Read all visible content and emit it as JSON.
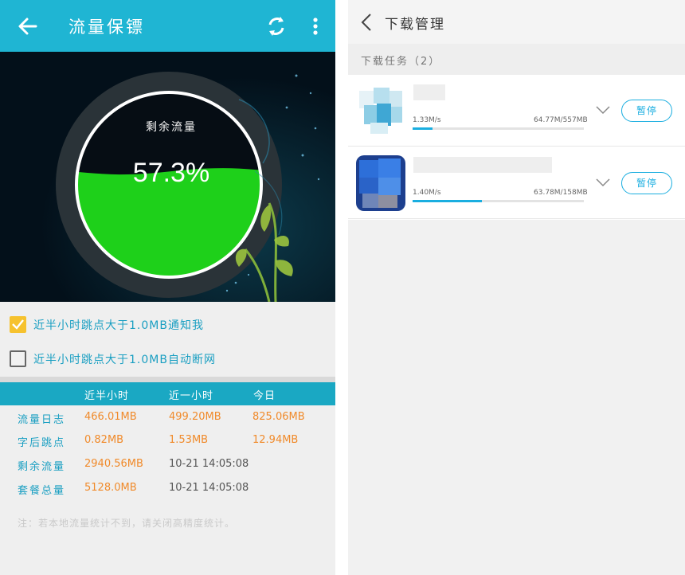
{
  "left": {
    "title": "流量保镖",
    "gauge": {
      "label": "剩余流量",
      "percent_text": "57.3%",
      "fill_fraction": 0.573,
      "fill_color": "#1ed01a"
    },
    "options": [
      {
        "label": "近半小时跳点大于1.0MB通知我",
        "checked": true
      },
      {
        "label": "近半小时跳点大于1.0MB自动断网",
        "checked": false
      }
    ],
    "table": {
      "headers": [
        "近半小时",
        "近一小时",
        "今日"
      ],
      "rows": [
        {
          "label": "流量日志",
          "c1": "466.01MB",
          "c2": "499.20MB",
          "c3": "825.06MB"
        },
        {
          "label": "字后跳点",
          "c1": "0.82MB",
          "c2": "1.53MB",
          "c3": "12.94MB"
        },
        {
          "label": "剩余流量",
          "c1": "2940.56MB",
          "c2": "10-21 14:05:08",
          "c3": ""
        },
        {
          "label": "套餐总量",
          "c1": "5128.0MB",
          "c2": "10-21 14:05:08",
          "c3": ""
        }
      ]
    },
    "note": "注：若本地流量统计不到，请关闭高精度统计。"
  },
  "right": {
    "title": "下载管理",
    "subtitle": "下载任务（2）",
    "tasks": [
      {
        "speed": "1.33M/s",
        "size": "64.77M/557MB",
        "progress": 0.116,
        "pause_label": "暂停"
      },
      {
        "speed": "1.40M/s",
        "size": "63.78M/158MB",
        "progress": 0.404,
        "pause_label": "暂停"
      }
    ]
  },
  "colors": {
    "accent": "#1fb5d3",
    "table_header": "#1aa8c3",
    "orange_values": "#f08a2a",
    "label_blue": "#1a9fc2",
    "checkbox_checked": "#f6c22e",
    "progress": "#1aaee0"
  },
  "icons": {
    "back": "arrow-left-icon",
    "refresh": "refresh-icon",
    "more": "more-vertical-icon",
    "right_back": "chevron-left-icon",
    "expand": "chevron-down-icon"
  }
}
